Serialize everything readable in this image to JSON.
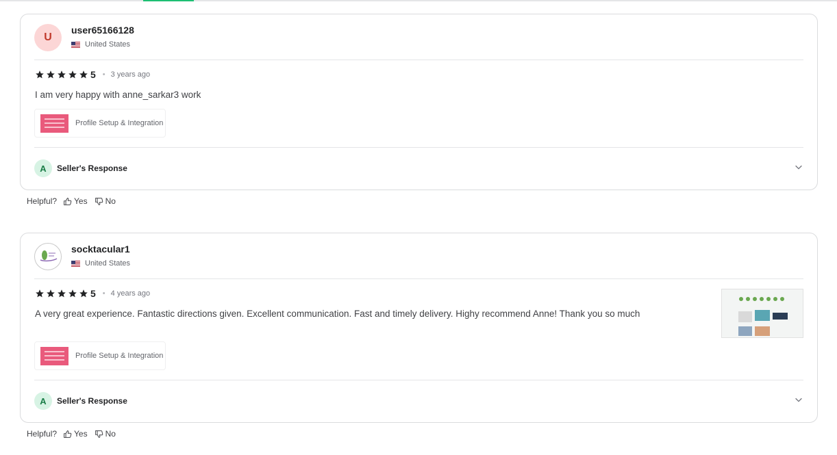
{
  "reviews": [
    {
      "avatar_letter": "U",
      "username": "user65166128",
      "country": "United States",
      "rating": "5",
      "time": "3 years ago",
      "text": "I am very happy with anne_sarkar3 work",
      "gig": "Profile Setup & Integration",
      "seller_avatar": "A",
      "seller_response": "Seller's Response"
    },
    {
      "username": "socktacular1",
      "country": "United States",
      "rating": "5",
      "time": "4 years ago",
      "text": "A very great experience. Fantastic directions given. Excellent communication. Fast and timely delivery. Highy recommend Anne! Thank you so much",
      "gig": "Profile Setup & Integration",
      "seller_avatar": "A",
      "seller_response": "Seller's Response"
    }
  ],
  "helpful": {
    "label": "Helpful?",
    "yes": "Yes",
    "no": "No"
  },
  "icons": {
    "star": "star-icon",
    "thumbs_up": "thumbs-up-icon",
    "thumbs_down": "thumbs-down-icon",
    "chevron": "chevron-down-icon",
    "flag": "us-flag-icon"
  },
  "colors": {
    "accent": "#1dbf73",
    "star": "#222325",
    "seller_avatar_bg": "#d7f3e4",
    "user_avatar_bg": "#fcd6d6"
  }
}
